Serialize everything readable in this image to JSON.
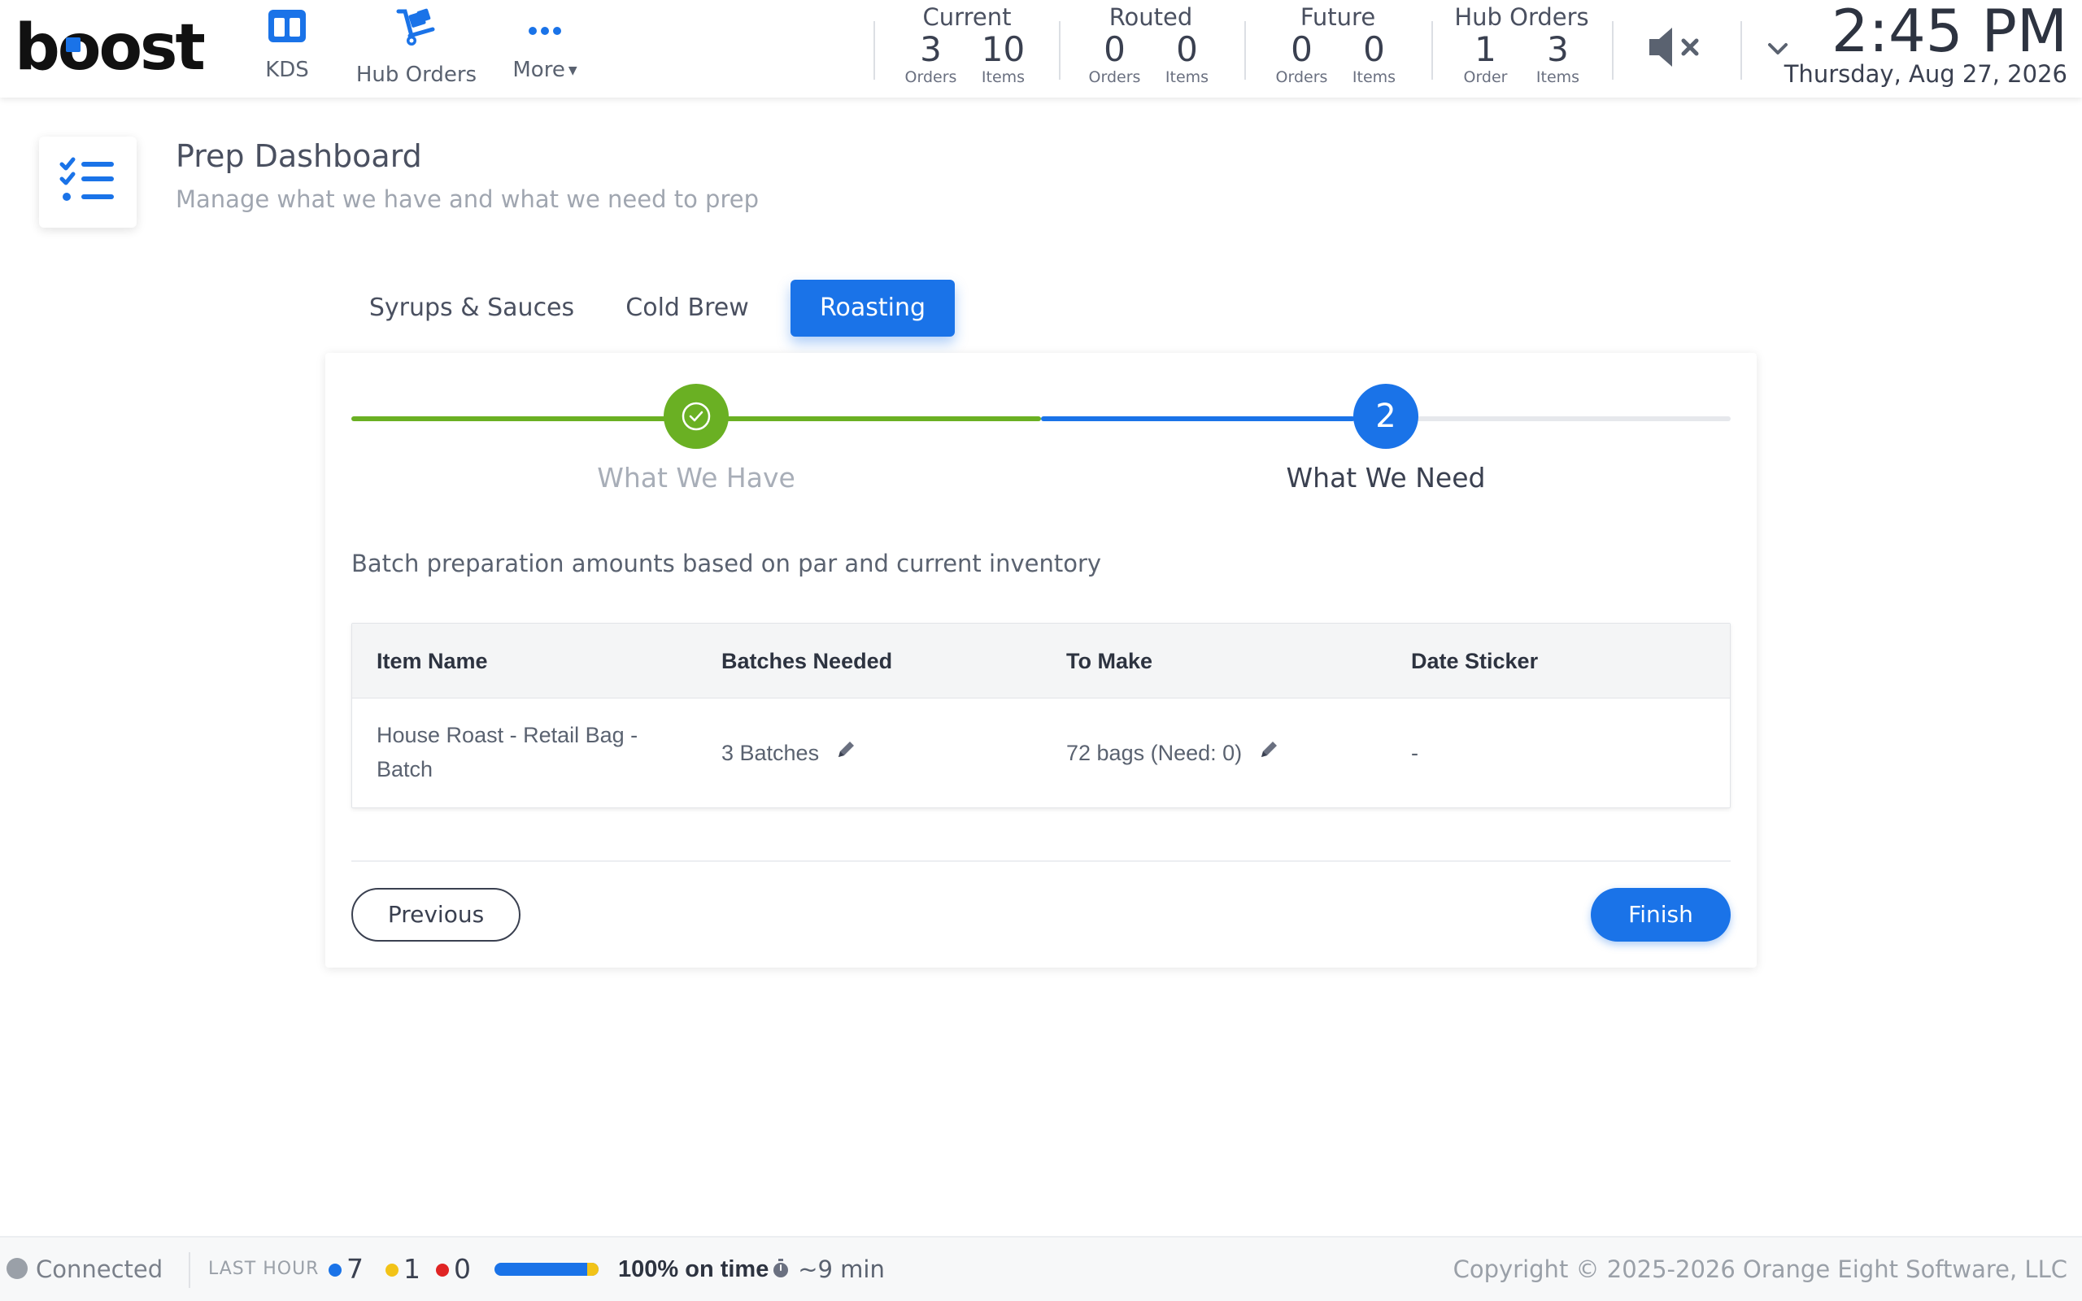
{
  "header": {
    "logo": "boost",
    "nav": [
      {
        "label": "KDS",
        "icon": "kds-grid-icon"
      },
      {
        "label": "Hub Orders",
        "icon": "hand-truck-icon"
      },
      {
        "label": "More",
        "icon": "more-dots-icon"
      }
    ],
    "stats": [
      {
        "title": "Current",
        "values": [
          {
            "num": "3",
            "sub": "Orders"
          },
          {
            "num": "10",
            "sub": "Items"
          }
        ]
      },
      {
        "title": "Routed",
        "values": [
          {
            "num": "0",
            "sub": "Orders"
          },
          {
            "num": "0",
            "sub": "Items"
          }
        ]
      },
      {
        "title": "Future",
        "values": [
          {
            "num": "0",
            "sub": "Orders"
          },
          {
            "num": "0",
            "sub": "Items"
          }
        ]
      },
      {
        "title": "Hub Orders",
        "values": [
          {
            "num": "1",
            "sub": "Order"
          },
          {
            "num": "3",
            "sub": "Items"
          }
        ]
      }
    ],
    "mute_icon": "speaker-muted-icon",
    "time": "2:45 PM",
    "date": "Thursday, Aug 27, 2026"
  },
  "page": {
    "icon": "checklist-icon",
    "title": "Prep Dashboard",
    "subtitle": "Manage what we have and what we need to prep"
  },
  "tabs": [
    {
      "label": "Syrups & Sauces",
      "active": false
    },
    {
      "label": "Cold Brew",
      "active": false
    },
    {
      "label": "Roasting",
      "active": true
    }
  ],
  "stepper": {
    "steps": [
      {
        "label": "What We Have",
        "state": "complete"
      },
      {
        "label": "What We Need",
        "number": "2",
        "state": "active"
      }
    ]
  },
  "description": "Batch preparation amounts based on par and current inventory",
  "table": {
    "columns": [
      "Item Name",
      "Batches Needed",
      "To Make",
      "Date Sticker"
    ],
    "rows": [
      {
        "item": "House Roast - Retail Bag - Batch",
        "batches": "3 Batches",
        "to_make": "72 bags (Need: 0)",
        "date_sticker": "-"
      }
    ]
  },
  "buttons": {
    "previous": "Previous",
    "finish": "Finish"
  },
  "footer": {
    "status": "Connected",
    "last_hour_label": "LAST HOUR",
    "counts": [
      {
        "color": "#1a73e8",
        "value": "7"
      },
      {
        "color": "#f2c318",
        "value": "1"
      },
      {
        "color": "#e02424",
        "value": "0"
      }
    ],
    "on_time_fraction": 0.9,
    "on_time": "100% on time",
    "avg_time": "~9 min",
    "copyright": "Copyright © 2025-2026 Orange Eight Software, LLC"
  },
  "colors": {
    "accent": "#1a73e8",
    "success": "#6ab023"
  }
}
